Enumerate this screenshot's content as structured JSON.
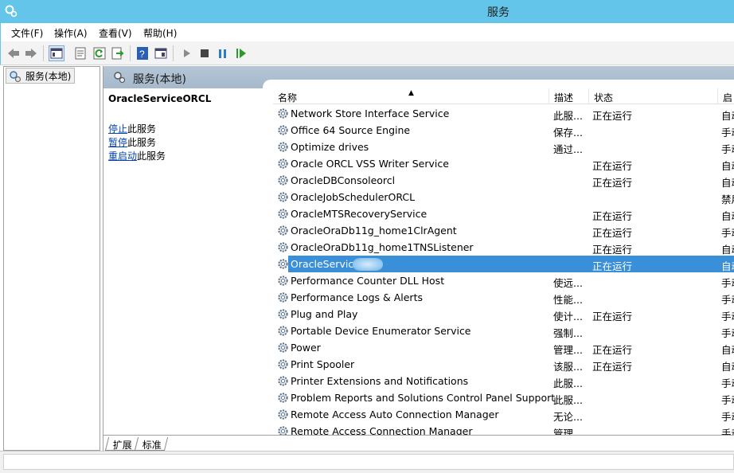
{
  "window": {
    "title": "服务"
  },
  "menu": [
    "文件(F)",
    "操作(A)",
    "查看(V)",
    "帮助(H)"
  ],
  "tree": {
    "item": "服务(本地)"
  },
  "pane": {
    "title": "服务(本地)"
  },
  "details": {
    "service_name": "OracleServiceORCL",
    "actions": [
      {
        "link": "停止",
        "suffix": "此服务"
      },
      {
        "link": "暂停",
        "suffix": "此服务"
      },
      {
        "link": "重启动",
        "suffix": "此服务"
      }
    ]
  },
  "columns": {
    "name": "名称",
    "desc": "描述",
    "status": "状态",
    "startup": "启动"
  },
  "rows": [
    {
      "name": "Network Store Interface Service",
      "desc": "此服...",
      "status": "正在运行",
      "startup": "自动"
    },
    {
      "name": "Office 64 Source Engine",
      "desc": "保存...",
      "status": "",
      "startup": "手动"
    },
    {
      "name": "Optimize drives",
      "desc": "通过...",
      "status": "",
      "startup": "手动"
    },
    {
      "name": "Oracle ORCL VSS Writer Service",
      "desc": "",
      "status": "正在运行",
      "startup": "自动"
    },
    {
      "name": "OracleDBConsoleorcl",
      "desc": "",
      "status": "正在运行",
      "startup": "自动"
    },
    {
      "name": "OracleJobSchedulerORCL",
      "desc": "",
      "status": "",
      "startup": "禁用"
    },
    {
      "name": "OracleMTSRecoveryService",
      "desc": "",
      "status": "正在运行",
      "startup": "自动"
    },
    {
      "name": "OracleOraDb11g_home1ClrAgent",
      "desc": "",
      "status": "正在运行",
      "startup": "手动"
    },
    {
      "name": "OracleOraDb11g_home1TNSListener",
      "desc": "",
      "status": "正在运行",
      "startup": "自动"
    },
    {
      "name": "OracleService",
      "desc": "",
      "status": "正在运行",
      "startup": "自动",
      "selected": true
    },
    {
      "name": "Performance Counter DLL Host",
      "desc": "使远...",
      "status": "",
      "startup": "手动"
    },
    {
      "name": "Performance Logs & Alerts",
      "desc": "性能...",
      "status": "",
      "startup": "手动"
    },
    {
      "name": "Plug and Play",
      "desc": "使计...",
      "status": "正在运行",
      "startup": "手动"
    },
    {
      "name": "Portable Device Enumerator Service",
      "desc": "强制...",
      "status": "",
      "startup": "手动"
    },
    {
      "name": "Power",
      "desc": "管理...",
      "status": "正在运行",
      "startup": "自动"
    },
    {
      "name": "Print Spooler",
      "desc": "该服...",
      "status": "正在运行",
      "startup": "自动"
    },
    {
      "name": "Printer Extensions and Notifications",
      "desc": "此服...",
      "status": "",
      "startup": "手动"
    },
    {
      "name": "Problem Reports and Solutions Control Panel Support",
      "desc": "此服...",
      "status": "",
      "startup": "手动"
    },
    {
      "name": "Remote Access Auto Connection Manager",
      "desc": "无论...",
      "status": "",
      "startup": "手动"
    },
    {
      "name": "Remote Access Connection Manager",
      "desc": "管理...",
      "status": "",
      "startup": "手动"
    }
  ],
  "tabs": [
    "扩展",
    "标准"
  ],
  "colors": {
    "titlebar": "#62c5e9",
    "selection": "#3a8fd9",
    "link": "#0645ad"
  }
}
